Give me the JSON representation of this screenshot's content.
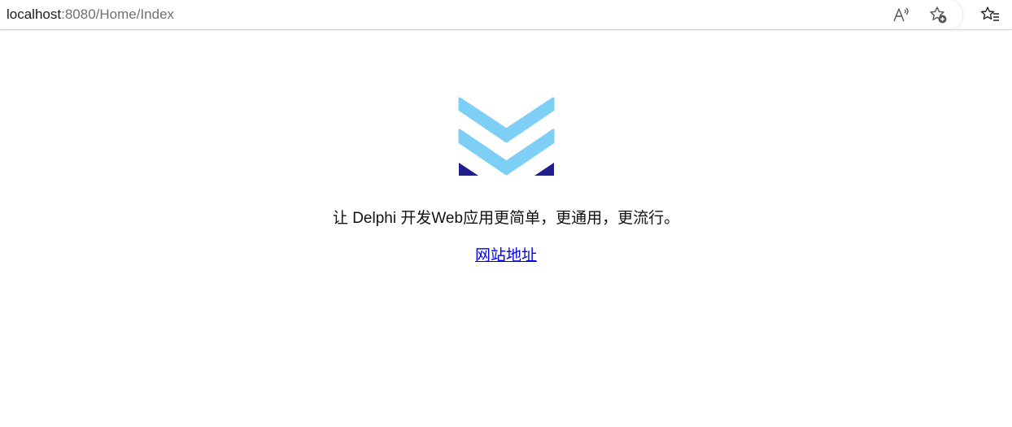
{
  "browser": {
    "url_host": "localhost",
    "url_rest": ":8080/Home/Index",
    "icons": [
      "read-aloud-icon",
      "add-favorite-icon",
      "favorites-icon"
    ]
  },
  "page": {
    "tagline": "让 Delphi 开发Web应用更简单，更通用，更流行。",
    "link_label": "网站地址"
  },
  "colors": {
    "logo_light": "#7ecff5",
    "logo_dark": "#1e1e8c",
    "link": "#0000ee"
  }
}
